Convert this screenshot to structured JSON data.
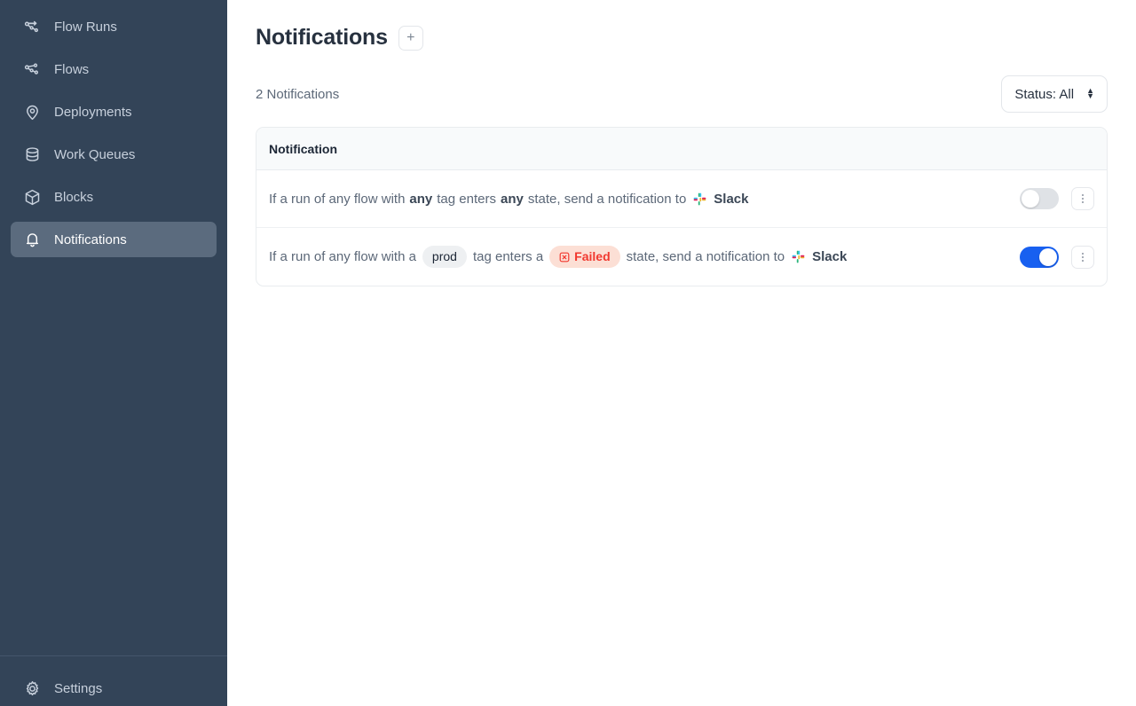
{
  "sidebar": {
    "items": [
      {
        "label": "Flow Runs",
        "icon": "flow-runs-icon",
        "active": false
      },
      {
        "label": "Flows",
        "icon": "flows-icon",
        "active": false
      },
      {
        "label": "Deployments",
        "icon": "deployments-icon",
        "active": false
      },
      {
        "label": "Work Queues",
        "icon": "work-queues-icon",
        "active": false
      },
      {
        "label": "Blocks",
        "icon": "blocks-icon",
        "active": false
      },
      {
        "label": "Notifications",
        "icon": "bell-icon",
        "active": true
      }
    ],
    "footer": {
      "label": "Settings",
      "icon": "gear-icon"
    },
    "colors": {
      "background": "#334458",
      "active_background": "#5b6b7e",
      "text": "#c7d0dc"
    }
  },
  "header": {
    "title": "Notifications",
    "add_button_label": "+"
  },
  "toolbar": {
    "count_text": "2 Notifications",
    "status_filter_label": "Status: All"
  },
  "table": {
    "column_header": "Notification",
    "rows": [
      {
        "prefix": "If a run of any flow with",
        "tag_bold": "any",
        "mid1": "tag enters",
        "state_bold": "any",
        "mid2": "state, send a notification to",
        "sink": "Slack",
        "sink_icon": "slack-icon",
        "enabled": false
      },
      {
        "prefix": "If a run of any flow with a",
        "tag_pill": "prod",
        "mid1": "tag enters a",
        "state_pill": "Failed",
        "state_icon": "failed-x-icon",
        "mid2": "state, send a notification to",
        "sink": "Slack",
        "sink_icon": "slack-icon",
        "enabled": true
      }
    ]
  },
  "colors": {
    "toggle_on": "#1860f0",
    "toggle_off": "#dfe2e6",
    "failed_badge_bg": "#fcdfd5",
    "failed_badge_text": "#f1382f",
    "tag_pill_bg": "#eef0f2"
  }
}
